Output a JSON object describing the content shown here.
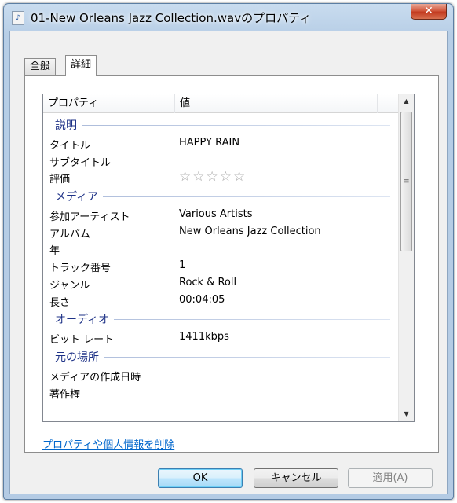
{
  "window": {
    "title": "01-New Orleans Jazz Collection.wavのプロパティ",
    "file_icon_glyph": "♪",
    "close_glyph": "✕"
  },
  "tabs": [
    {
      "label": "全般",
      "active": false
    },
    {
      "label": "詳細",
      "active": true
    }
  ],
  "list": {
    "columns": {
      "property": "プロパティ",
      "value": "値"
    },
    "sections": [
      {
        "title": "説明",
        "rows": [
          {
            "name": "タイトル",
            "value": "HAPPY RAIN"
          },
          {
            "name": "サブタイトル",
            "value": ""
          },
          {
            "name": "評価",
            "value": "",
            "rating": 0,
            "rating_max": 5
          }
        ]
      },
      {
        "title": "メディア",
        "rows": [
          {
            "name": "参加アーティスト",
            "value": "Various Artists"
          },
          {
            "name": "アルバム",
            "value": "New Orleans Jazz Collection"
          },
          {
            "name": "年",
            "value": ""
          },
          {
            "name": "トラック番号",
            "value": "1"
          },
          {
            "name": "ジャンル",
            "value": "Rock & Roll"
          },
          {
            "name": "長さ",
            "value": "00:04:05"
          }
        ]
      },
      {
        "title": "オーディオ",
        "rows": [
          {
            "name": "ビット レート",
            "value": "1411kbps"
          }
        ]
      },
      {
        "title": "元の場所",
        "rows": [
          {
            "name": "メディアの作成日時",
            "value": ""
          },
          {
            "name": "著作権",
            "value": ""
          }
        ]
      }
    ]
  },
  "scrollbar": {
    "up_glyph": "▲",
    "down_glyph": "▼",
    "grip_glyph": "≡"
  },
  "remove_link": "プロパティや個人情報を削除",
  "buttons": {
    "ok": "OK",
    "cancel": "キャンセル",
    "apply": "適用(A)"
  },
  "colors": {
    "section_title": "#1e3287",
    "link": "#0066cc",
    "star": "#a8a8a8"
  }
}
